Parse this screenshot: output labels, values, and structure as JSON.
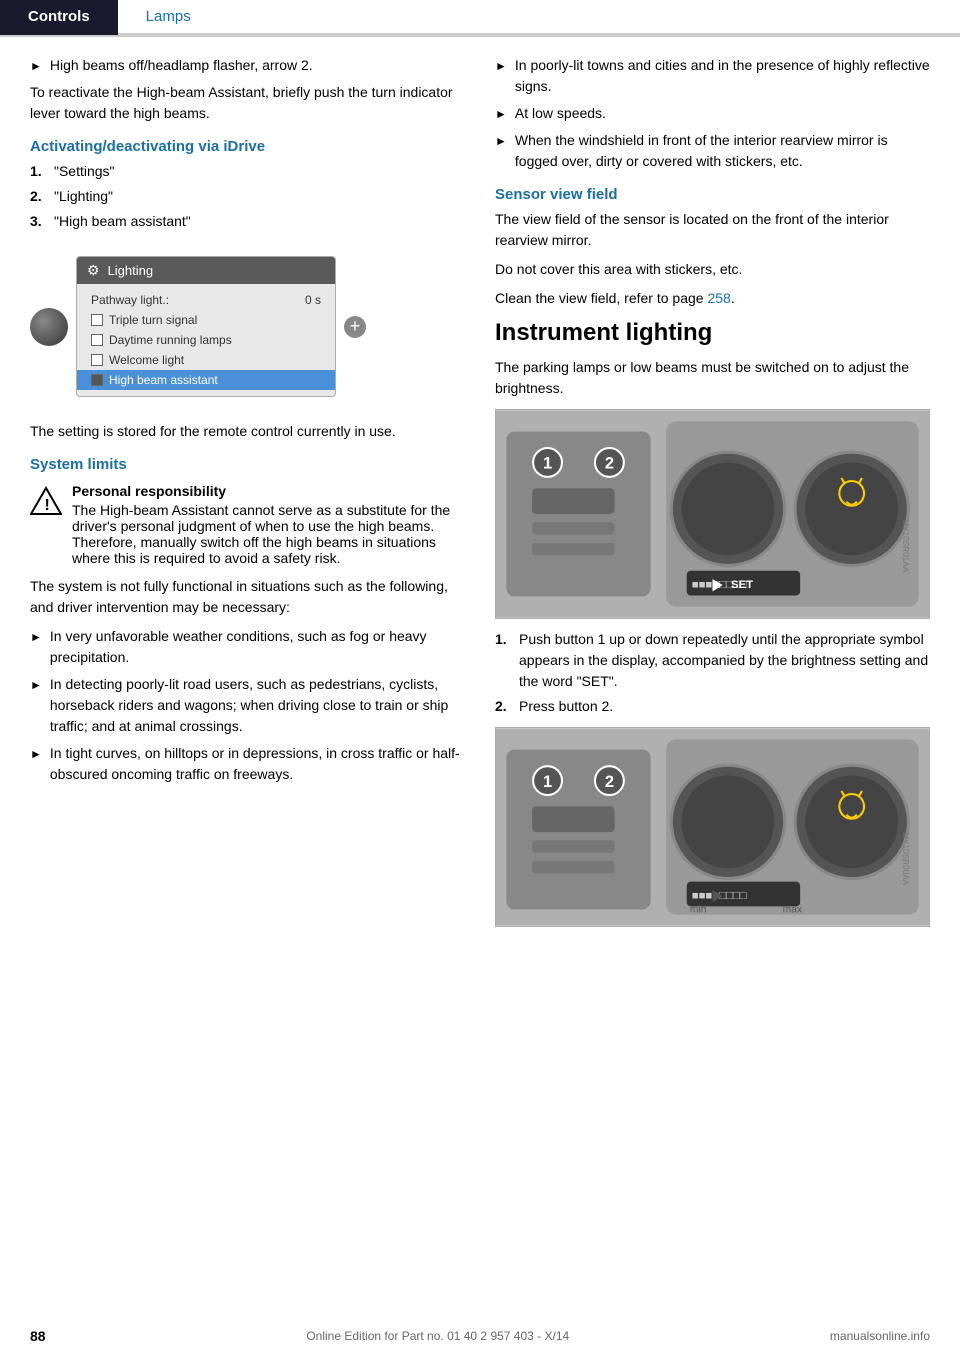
{
  "header": {
    "tab_active": "Controls",
    "tab_inactive": "Lamps"
  },
  "left_col": {
    "bullet_high_beams": "High beams off/headlamp flasher, arrow 2.",
    "reactivate_para": "To reactivate the High-beam Assistant, briefly push the turn indicator lever toward the high beams.",
    "section_idrive": "Activating/deactivating via iDrive",
    "step1": "\"Settings\"",
    "step2": "\"Lighting\"",
    "step3": "\"High beam assistant\"",
    "idrive_title": "Lighting",
    "idrive_row1_label": "Pathway light.:",
    "idrive_row1_val": "0 s",
    "idrive_row2": "Triple turn signal",
    "idrive_row3": "Daytime running lamps",
    "idrive_row4": "Welcome light",
    "idrive_row5": "High beam assistant",
    "setting_stored": "The setting is stored for the remote control currently in use.",
    "section_system": "System limits",
    "warning_title": "Personal responsibility",
    "warning_body": "The High-beam Assistant cannot serve as a substitute for the driver's personal judgment of when to use the high beams. Therefore, manually switch off the high beams in situations where this is required to avoid a safety risk.",
    "system_para": "The system is not fully functional in situations such as the following, and driver intervention may be necessary:",
    "bullet1": "In very unfavorable weather conditions, such as fog or heavy precipitation.",
    "bullet2": "In detecting poorly-lit road users, such as pedestrians, cyclists, horseback riders and wagons; when driving close to train or ship traffic; and at animal crossings.",
    "bullet3": "In tight curves, on hilltops or in depressions, in cross traffic or half-obscured oncoming traffic on freeways."
  },
  "right_col": {
    "bullet_r1": "In poorly-lit towns and cities and in the presence of highly reflective signs.",
    "bullet_r2": "At low speeds.",
    "bullet_r3": "When the windshield in front of the interior rearview mirror is fogged over, dirty or covered with stickers, etc.",
    "section_sensor": "Sensor view field",
    "sensor_p1": "The view field of the sensor is located on the front of the interior rearview mirror.",
    "sensor_p2": "Do not cover this area with stickers, etc.",
    "sensor_p3_pre": "Clean the view field, refer to page ",
    "sensor_p3_link": "258",
    "sensor_p3_post": ".",
    "big_heading": "Instrument lighting",
    "instrument_p1": "The parking lamps or low beams must be switched on to adjust the brightness.",
    "step_r1": "Push button 1 up or down repeatedly until the appropriate symbol appears in the display, accompanied by the brightness setting and the word \"SET\".",
    "step_r2": "Press button 2.",
    "instrument_img_label": "Instrument cluster brightness control",
    "instrument_img2_label": "Instrument cluster brightness control 2"
  },
  "footer": {
    "page_num": "88",
    "copyright": "Online Edition for Part no. 01 40 2 957 403 - X/14",
    "watermark": "manualsonline.info"
  }
}
